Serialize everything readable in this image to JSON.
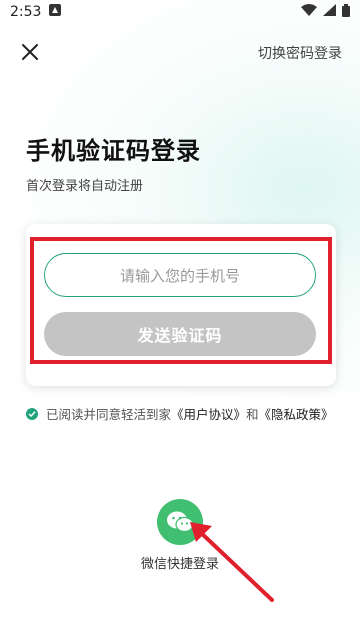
{
  "status_bar": {
    "time": "2:53"
  },
  "nav": {
    "switch_label": "切换密码登录"
  },
  "title": "手机验证码登录",
  "subtitle": "首次登录将自动注册",
  "phone_input": {
    "placeholder": "请输入您的手机号"
  },
  "send_button": {
    "label": "发送验证码"
  },
  "agreement": {
    "prefix": "已阅读并同意轻活到家",
    "user_agreement": "《用户协议》",
    "and": "和",
    "privacy_policy": "《隐私政策》"
  },
  "wechat": {
    "label": "微信快捷登录"
  },
  "colors": {
    "accent": "#22a37e",
    "highlight": "#e0202c",
    "wechat": "#3fbf6f",
    "button_disabled": "#c4c4c4"
  }
}
